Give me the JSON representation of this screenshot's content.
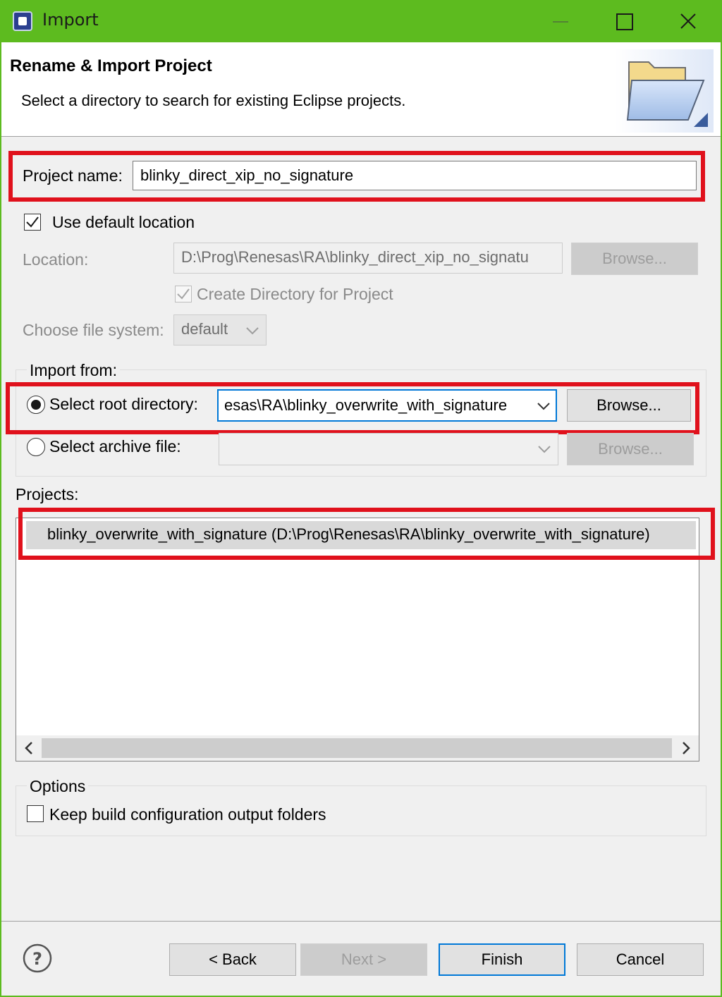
{
  "window": {
    "title": "Import",
    "accent_color": "#5dbb1f"
  },
  "banner": {
    "title": "Rename & Import Project",
    "subtitle": "Select a directory to search for existing Eclipse projects.",
    "icon": "folder-icon"
  },
  "project_name": {
    "label": "Project name:",
    "value": "blinky_direct_xip_no_signature"
  },
  "use_default_location": {
    "label": "Use default location",
    "checked": true
  },
  "location": {
    "label": "Location:",
    "value": "D:\\Prog\\Renesas\\RA\\blinky_direct_xip_no_signatu",
    "browse_label": "Browse..."
  },
  "create_directory": {
    "label": "Create Directory for Project",
    "checked": true
  },
  "file_system": {
    "label": "Choose file system:",
    "value": "default"
  },
  "import_from": {
    "group_label": "Import from:",
    "root_directory_label": "Select root directory:",
    "root_directory_value": "esas\\RA\\blinky_overwrite_with_signature",
    "root_browse_label": "Browse...",
    "archive_label": "Select archive file:",
    "archive_value": "",
    "archive_browse_label": "Browse..."
  },
  "projects": {
    "label": "Projects:",
    "items": [
      "blinky_overwrite_with_signature (D:\\Prog\\Renesas\\RA\\blinky_overwrite_with_signature)"
    ]
  },
  "options": {
    "group_label": "Options",
    "keep_build_label": "Keep build configuration output folders",
    "keep_build_checked": false
  },
  "footer": {
    "help_icon": "help-icon",
    "back_label": "< Back",
    "next_label": "Next >",
    "finish_label": "Finish",
    "cancel_label": "Cancel"
  },
  "highlight_color": "#e0111c"
}
